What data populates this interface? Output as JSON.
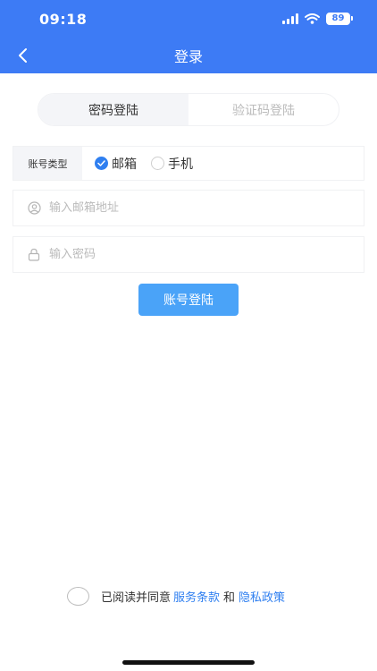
{
  "status_bar": {
    "time": "09:18",
    "battery": "89"
  },
  "header": {
    "title": "登录"
  },
  "tabs": [
    {
      "label": "密码登陆",
      "active": true
    },
    {
      "label": "验证码登陆",
      "active": false
    }
  ],
  "account_type": {
    "label": "账号类型",
    "options": [
      {
        "label": "邮箱",
        "checked": true
      },
      {
        "label": "手机",
        "checked": false
      }
    ]
  },
  "email_field": {
    "placeholder": "输入邮箱地址",
    "value": ""
  },
  "password_field": {
    "placeholder": "输入密码",
    "value": ""
  },
  "login_button": {
    "label": "账号登陆"
  },
  "agreement": {
    "prefix": "已阅读并同意",
    "terms_link": "服务条款",
    "conjunction": "和",
    "privacy_link": "隐私政策"
  },
  "colors": {
    "header": "#3d7bf5",
    "button": "#4aa3f8",
    "link": "#2f7ff0"
  }
}
